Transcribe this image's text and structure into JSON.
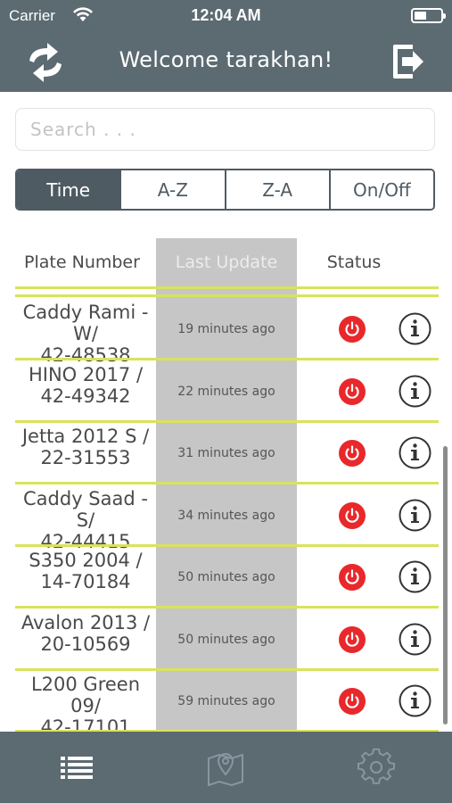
{
  "status_bar": {
    "carrier": "Carrier",
    "time": "12:04 AM"
  },
  "header": {
    "title": "Welcome tarakhan!",
    "refresh_icon": "refresh-arrows-icon",
    "logout_icon": "logout-icon"
  },
  "search": {
    "placeholder": "Search . . .",
    "value": ""
  },
  "sort_tabs": {
    "selected": "Time",
    "items": [
      "Time",
      "A-Z",
      "Z-A",
      "On/Off"
    ]
  },
  "table": {
    "columns": [
      "Plate Number",
      "Last Update",
      "Status"
    ],
    "highlighted_column": "Last Update",
    "rows": [
      {
        "plate_line1": "Caddy Rami -W/",
        "plate_line2": "42-48538",
        "updated": "19 minutes ago",
        "status": "off"
      },
      {
        "plate_line1": "HINO 2017 /",
        "plate_line2": "42-49342",
        "updated": "22 minutes ago",
        "status": "off"
      },
      {
        "plate_line1": "Jetta 2012 S /",
        "plate_line2": "22-31553",
        "updated": "31 minutes ago",
        "status": "off"
      },
      {
        "plate_line1": "Caddy Saad -S/",
        "plate_line2": "42-44415",
        "updated": "34 minutes ago",
        "status": "off"
      },
      {
        "plate_line1": "S350 2004 /",
        "plate_line2": "14-70184",
        "updated": "50 minutes ago",
        "status": "off"
      },
      {
        "plate_line1": "Avalon 2013 /",
        "plate_line2": "20-10569",
        "updated": "50 minutes ago",
        "status": "off"
      },
      {
        "plate_line1": "L200 Green 09/",
        "plate_line2": "42-17101",
        "updated": "59 minutes ago",
        "status": "off"
      }
    ]
  },
  "tab_bar": {
    "items": [
      {
        "icon": "list-icon",
        "active": true
      },
      {
        "icon": "map-pin-icon",
        "active": false
      },
      {
        "icon": "gear-icon",
        "active": false
      }
    ]
  },
  "colors": {
    "header_bg": "#5c6a72",
    "accent_line": "#d9e35a",
    "power_red": "#e8282b",
    "highlight_column": "#c6c6c6"
  }
}
